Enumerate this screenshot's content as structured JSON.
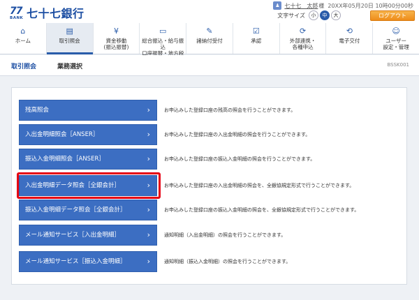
{
  "bank": {
    "logo_number": "77",
    "logo_sub": "BANK",
    "name": "七十七銀行"
  },
  "user": {
    "name": "七十七　太郎",
    "honorific": "様",
    "datetime": "20XX年05月20日 10時00分00秒"
  },
  "fontsize": {
    "label": "文字サイズ",
    "small": "小",
    "medium": "中",
    "large": "大"
  },
  "logout_label": "ログアウト",
  "nav": [
    {
      "icon": "⌂",
      "l1": "ホーム",
      "l2": ""
    },
    {
      "icon": "▤",
      "l1": "取引照会",
      "l2": ""
    },
    {
      "icon": "¥",
      "l1": "資金移動",
      "l2": "(振込振替)"
    },
    {
      "icon": "▭",
      "l1": "総合振込・給与振込",
      "l2": "口座振替・地方税"
    },
    {
      "icon": "✎",
      "l1": "諸納付受付",
      "l2": ""
    },
    {
      "icon": "☑",
      "l1": "承認",
      "l2": ""
    },
    {
      "icon": "⟳",
      "l1": "外部連携・",
      "l2": "各種申込"
    },
    {
      "icon": "⟲",
      "l1": "電子交付",
      "l2": ""
    },
    {
      "icon": "☺",
      "l1": "ユーザー",
      "l2": "設定・管理"
    }
  ],
  "breadcrumb": {
    "section": "取引照会",
    "page": "業務選択",
    "screen_id": "BSSK001"
  },
  "menu": [
    {
      "label": "残高照会",
      "desc": "お申込みした登録口座の残高の照会を行うことができます。"
    },
    {
      "label": "入出金明細照会［ANSER］",
      "desc": "お申込みした登録口座の入出金明細の照会を行うことができます。"
    },
    {
      "label": "振込入金明細照会［ANSER］",
      "desc": "お申込みした登録口座の振込入金明細の照会を行うことができます。"
    },
    {
      "label": "入出金明細データ照会［全銀会計］",
      "desc": "お申込みした登録口座の入出金明細の照会を、全銀協規定形式で行うことができます。"
    },
    {
      "label": "振込入金明細データ照会［全銀会計］",
      "desc": "お申込みした登録口座の振込入金明細の照会を、全銀協規定形式で行うことができます。"
    },
    {
      "label": "メール通知サービス［入出金明細］",
      "desc": "通知明細（入出金明細）の照会を行うことができます。"
    },
    {
      "label": "メール通知サービス［振込入金明細］",
      "desc": "通知明細（振込入金明細）の照会を行うことができます。"
    }
  ],
  "colors": {
    "brand": "#1d4fa3",
    "button": "#3c6ec2",
    "highlight": "#e60012",
    "logout": "#ee8c1a"
  }
}
